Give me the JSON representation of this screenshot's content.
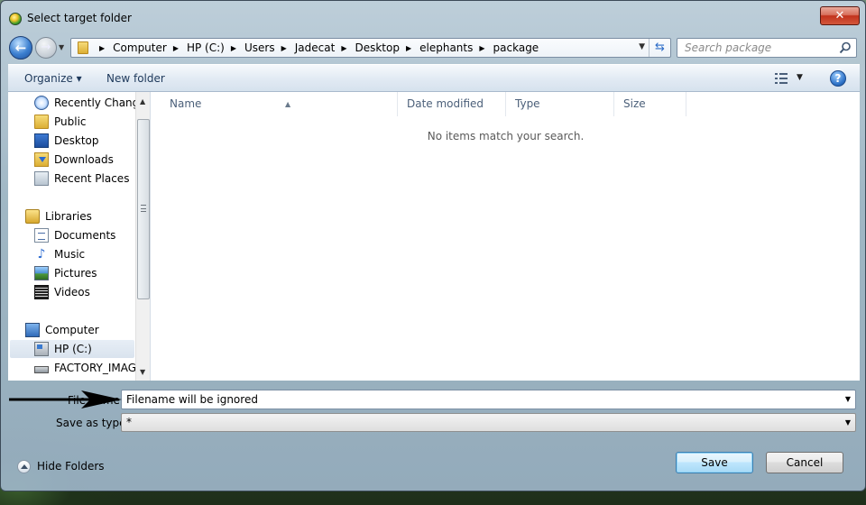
{
  "window": {
    "title": "Select target folder",
    "close_glyph": "✕"
  },
  "navigation": {
    "back_glyph": "←",
    "forward_glyph": "→",
    "breadcrumbs": [
      "Computer",
      "HP (C:)",
      "Users",
      "Jadecat",
      "Desktop",
      "elephants",
      "package"
    ],
    "search_placeholder": "Search package"
  },
  "toolbar": {
    "organize_label": "Organize ▾",
    "new_folder_label": "New folder",
    "help_glyph": "?"
  },
  "sidebar": {
    "items": [
      {
        "label": "Recently Changed",
        "icon": "clock-icon"
      },
      {
        "label": "Public",
        "icon": "folder-icon"
      },
      {
        "label": "Desktop",
        "icon": "desktop-icon"
      },
      {
        "label": "Downloads",
        "icon": "downloads-icon"
      },
      {
        "label": "Recent Places",
        "icon": "recent-places-icon"
      },
      {
        "label": "Libraries",
        "icon": "libraries-icon"
      },
      {
        "label": "Documents",
        "icon": "documents-icon"
      },
      {
        "label": "Music",
        "icon": "music-icon"
      },
      {
        "label": "Pictures",
        "icon": "pictures-icon"
      },
      {
        "label": "Videos",
        "icon": "videos-icon"
      },
      {
        "label": "Computer",
        "icon": "computer-icon"
      },
      {
        "label": "HP (C:)",
        "icon": "drive-icon",
        "selected": true
      },
      {
        "label": "FACTORY_IMAGE",
        "icon": "removable-drive-icon"
      }
    ]
  },
  "file_list": {
    "columns": [
      "Name",
      "Date modified",
      "Type",
      "Size"
    ],
    "empty_message": "No items match your search."
  },
  "form": {
    "filename_label": "File name:",
    "filename_value": "Filename will be ignored",
    "savetype_label": "Save as type:",
    "savetype_value": "*"
  },
  "footer": {
    "hide_folders_label": "Hide Folders",
    "save_label": "Save",
    "cancel_label": "Cancel"
  },
  "colors": {
    "accent": "#3c7fb1",
    "toolbar_text": "#1e395b",
    "column_header_text": "#4c607a"
  }
}
